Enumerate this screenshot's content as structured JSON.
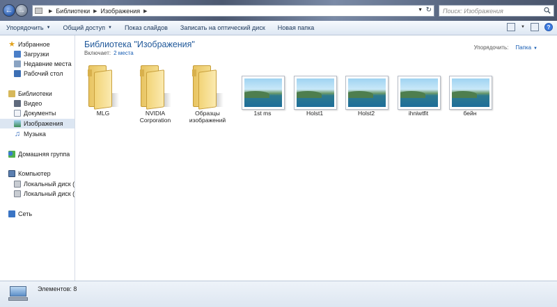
{
  "address": {
    "crumbs": [
      "Библиотеки",
      "Изображения"
    ],
    "search_placeholder": "Поиск: Изображения"
  },
  "toolbar": {
    "items": [
      "Упорядочить",
      "Общий доступ",
      "Показ слайдов",
      "Записать на оптический диск",
      "Новая папка"
    ]
  },
  "sidebar": {
    "favorites": "Избранное",
    "downloads": "Загрузки",
    "recent": "Недавние места",
    "desktop": "Рабочий стол",
    "libraries": "Библиотеки",
    "video": "Видео",
    "documents": "Документы",
    "images": "Изображения",
    "music": "Музыка",
    "homegroup": "Домашняя группа",
    "computer": "Компьютер",
    "disk_c": "Локальный диск (C",
    "disk_d": "Локальный диск (D",
    "network": "Сеть"
  },
  "content": {
    "title": "Библиотека \"Изображения\"",
    "includes_label": "Включает:",
    "includes_link": "2 места",
    "arrange_label": "Упорядочить:",
    "arrange_value": "Папка"
  },
  "items": [
    {
      "label": "MLG",
      "kind": "folder"
    },
    {
      "label": "NVIDIA Corporation",
      "kind": "folder"
    },
    {
      "label": "Образцы изображений",
      "kind": "folder"
    },
    {
      "label": "1st ms",
      "kind": "image"
    },
    {
      "label": "Holst1",
      "kind": "image"
    },
    {
      "label": "Holst2",
      "kind": "image"
    },
    {
      "label": "ihniwtfit",
      "kind": "image"
    },
    {
      "label": "бейн",
      "kind": "image"
    }
  ],
  "status": {
    "count": "Элементов: 8"
  }
}
